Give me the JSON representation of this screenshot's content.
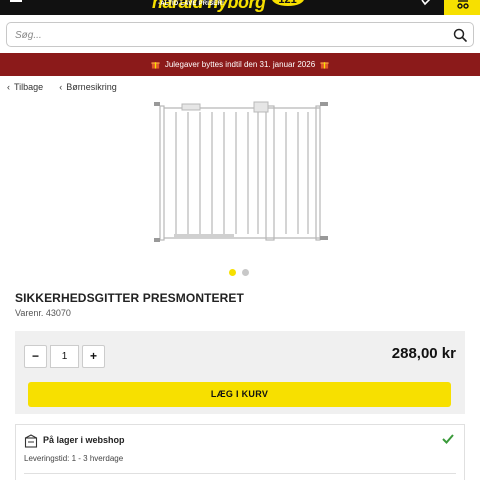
{
  "header": {
    "logo_text": "harald nyborg",
    "logo_tagline": "-ALTID LAVE PRISER!",
    "logo_badge": "121",
    "menu_icon": "hamburger-menu-icon",
    "account_icon": "user-check-icon",
    "cart_icon": "cart-icon",
    "brand_yellow": "#f7e000",
    "brand_black": "#111111"
  },
  "search": {
    "placeholder": "Søg...",
    "value": "",
    "icon": "search-icon"
  },
  "banner": {
    "text": "Julegaver byttes indtil den 31. januar 2026",
    "icon": "gift-icon",
    "color": "#8b1a1a"
  },
  "breadcrumbs": [
    {
      "label": "Tilbage"
    },
    {
      "label": "Børnesikring"
    }
  ],
  "gallery": {
    "image_name": "safety-gate-image",
    "slide_count": 2,
    "active_slide": 1
  },
  "product": {
    "title": "SIKKERHEDSGITTER PRESMONTERET",
    "sku": "Varenr. 43070",
    "price": "288,00 kr",
    "quantity": "1",
    "minus_label": "−",
    "plus_label": "+",
    "add_to_cart_label": "LÆG I KURV"
  },
  "stock": {
    "title": "På lager i webshop",
    "delivery": "Leveringstid: 1 - 3 hverdage",
    "status_icon": "check-icon",
    "status_color": "#3a9a3a"
  }
}
